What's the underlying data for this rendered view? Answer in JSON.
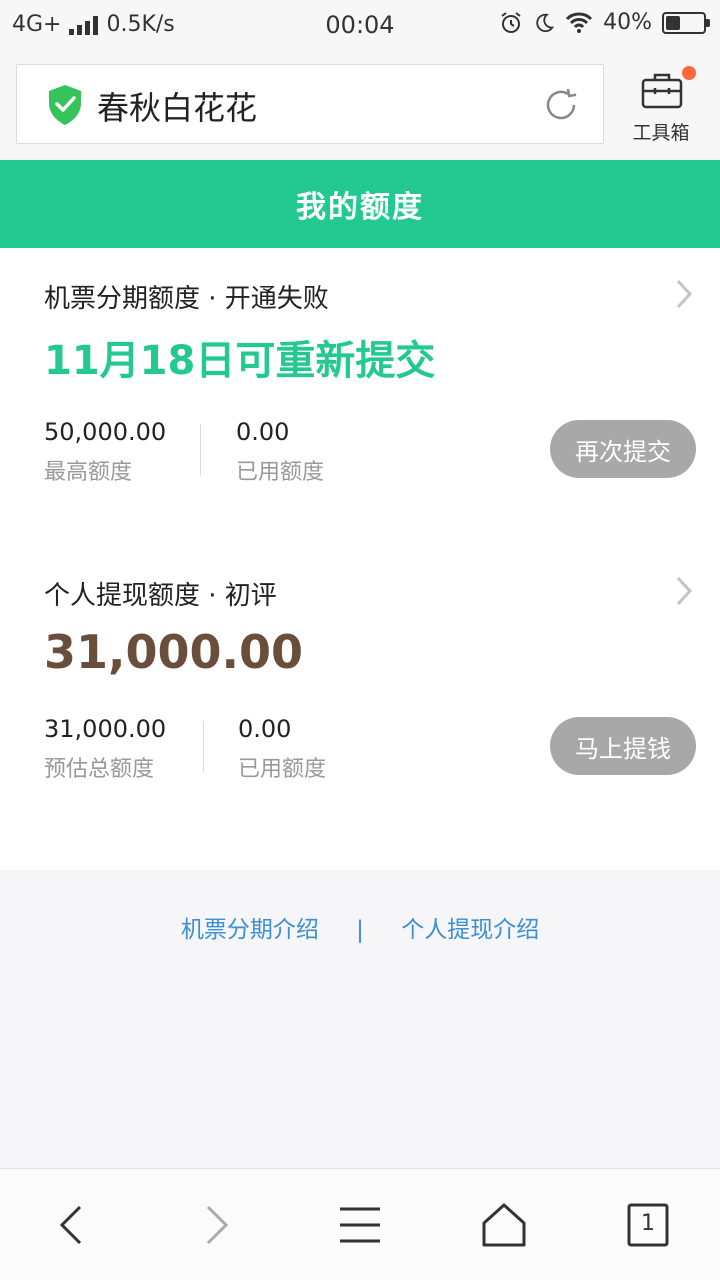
{
  "status_bar": {
    "network": "4G+",
    "speed": "0.5K/s",
    "time": "00:04",
    "battery": "40%",
    "battery_level": 0.4
  },
  "top_bar": {
    "site_title": "春秋白花花",
    "toolbox_label": "工具箱",
    "icons": [
      "shield-check-icon",
      "refresh-icon",
      "toolbox-icon"
    ]
  },
  "header": {
    "title": "我的额度",
    "bg_color": "#24c891"
  },
  "cards": [
    {
      "title": "机票分期额度 · 开通失败",
      "headline": "11月18日可重新提交",
      "metric1_value": "50,000.00",
      "metric1_label": "最高额度",
      "metric2_value": "0.00",
      "metric2_label": "已用额度",
      "button": "再次提交"
    },
    {
      "title": "个人提现额度 · 初评",
      "headline": "31,000.00",
      "metric1_value": "31,000.00",
      "metric1_label": "预估总额度",
      "metric2_value": "0.00",
      "metric2_label": "已用额度",
      "button": "马上提钱"
    }
  ],
  "footer": {
    "link1": "机票分期介绍",
    "separator": "|",
    "link2": "个人提现介绍"
  },
  "bottom_nav": {
    "tabs_count": "1",
    "icons": [
      "back-icon",
      "forward-icon",
      "menu-icon",
      "home-icon",
      "tabs-icon"
    ]
  }
}
